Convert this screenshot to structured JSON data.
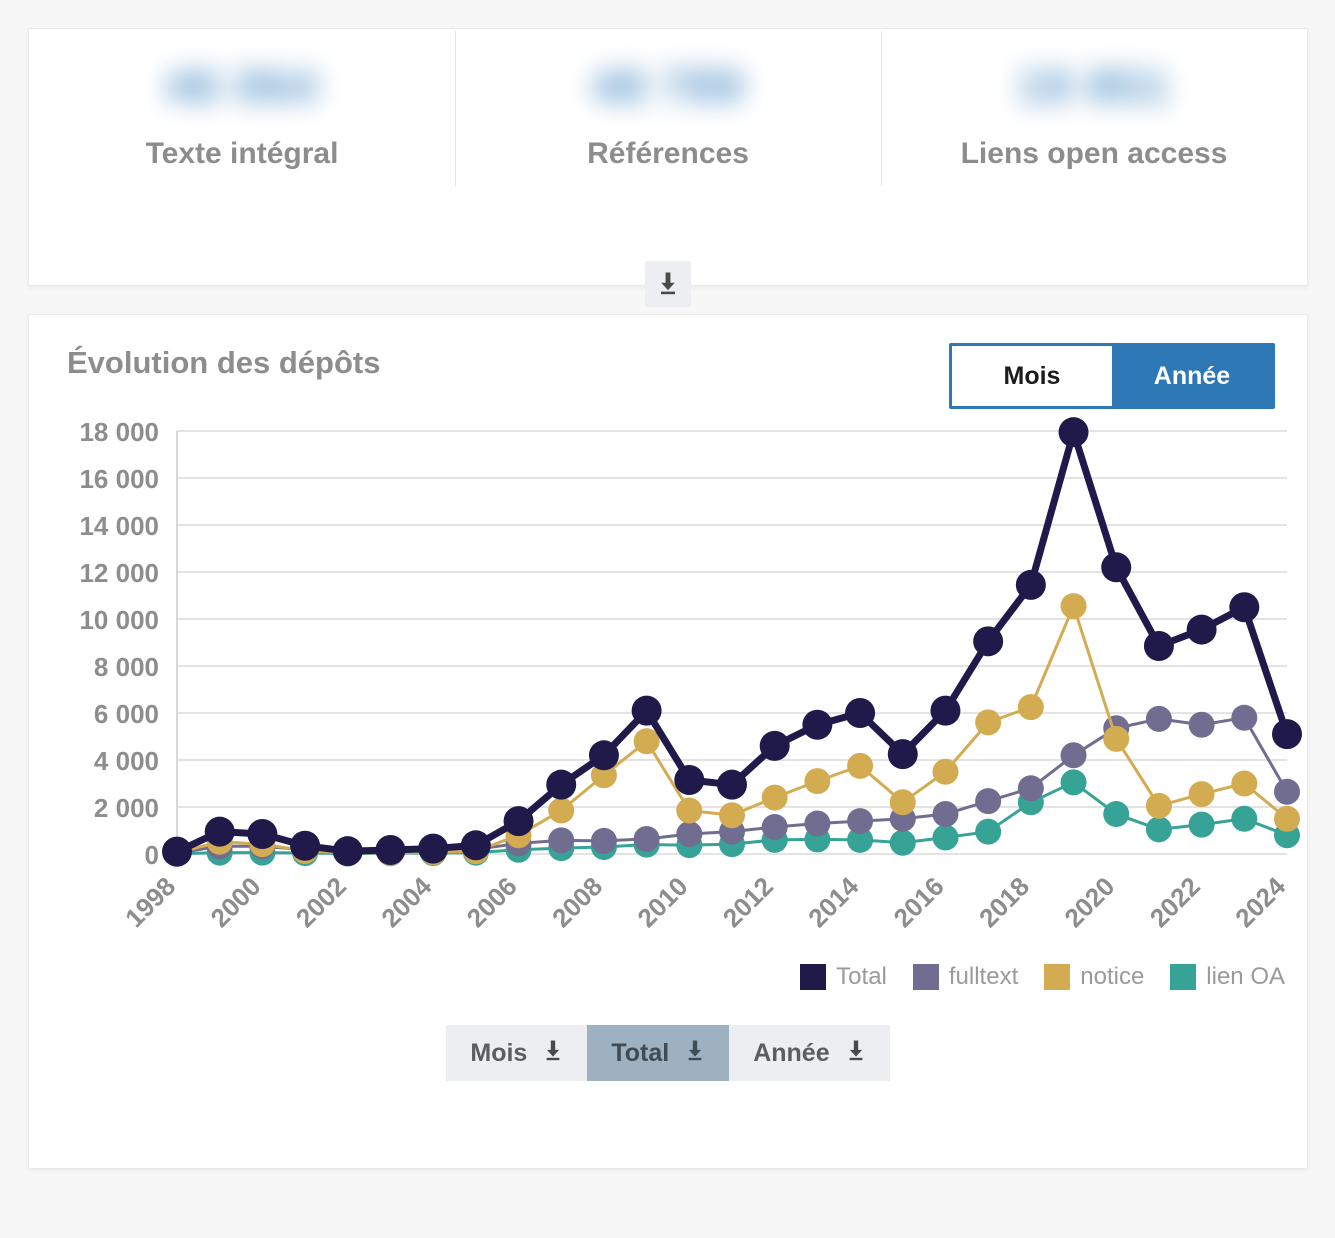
{
  "stats": {
    "items": [
      {
        "value": "46 064",
        "label": "Texte intégral",
        "redacted": true
      },
      {
        "value": "48 789",
        "label": "Références",
        "redacted": true
      },
      {
        "value": "19 851",
        "label": "Liens open access",
        "redacted": true
      }
    ],
    "download_icon": "download-icon"
  },
  "chart_panel": {
    "title": "Évolution des dépôts",
    "granularity": {
      "options": [
        "Mois",
        "Année"
      ],
      "selected": "Année"
    },
    "exports": [
      {
        "label": "Mois",
        "icon": "download-icon",
        "highlighted": false
      },
      {
        "label": "Total",
        "icon": "download-icon",
        "highlighted": true
      },
      {
        "label": "Année",
        "icon": "download-icon",
        "highlighted": false
      }
    ]
  },
  "colors": {
    "accent_blue": "#2e79b5",
    "total": "#1f1a4a",
    "fulltext": "#706d90",
    "notice": "#d3ac52",
    "lien_oa": "#37a396",
    "grid": "#e3e3e3",
    "axis_text": "#8d8d8d",
    "page_bg": "#f7f7f7",
    "card_bg": "#ffffff",
    "export_bg": "#eceef1",
    "export_highlight": "#9db1c1"
  },
  "chart_data": {
    "type": "line",
    "title": "Évolution des dépôts",
    "xlabel": "",
    "ylabel": "",
    "grid": true,
    "legend_position": "bottom-right",
    "ylim": [
      0,
      18000
    ],
    "yticks": [
      0,
      2000,
      4000,
      6000,
      8000,
      10000,
      12000,
      14000,
      16000,
      18000
    ],
    "ytick_labels": [
      "0",
      "2 000",
      "4 000",
      "6 000",
      "8 000",
      "10 000",
      "12 000",
      "14 000",
      "16 000",
      "18 000"
    ],
    "x": [
      1998,
      1999,
      2000,
      2001,
      2002,
      2003,
      2004,
      2005,
      2006,
      2007,
      2008,
      2009,
      2010,
      2011,
      2012,
      2013,
      2014,
      2015,
      2016,
      2017,
      2018,
      2019,
      2020,
      2021,
      2022,
      2023,
      2024
    ],
    "xtick_labels": [
      "1998",
      "2000",
      "2002",
      "2004",
      "2006",
      "2008",
      "2010",
      "2012",
      "2014",
      "2016",
      "2018",
      "2020",
      "2022",
      "2024"
    ],
    "series": [
      {
        "name": "Total",
        "color": "#1f1a4a",
        "values": [
          100,
          950,
          850,
          350,
          120,
          170,
          230,
          370,
          1400,
          2950,
          4200,
          6100,
          3150,
          2950,
          4600,
          5500,
          6000,
          4250,
          6100,
          9050,
          11450,
          17950,
          12200,
          8850,
          9550,
          10500,
          5100
        ]
      },
      {
        "name": "fulltext",
        "color": "#706d90",
        "values": [
          40,
          330,
          330,
          180,
          70,
          100,
          130,
          200,
          450,
          580,
          560,
          640,
          850,
          950,
          1150,
          1300,
          1400,
          1500,
          1700,
          2250,
          2800,
          4200,
          5350,
          5750,
          5500,
          5800,
          2650
        ]
      },
      {
        "name": "notice",
        "color": "#d3ac52",
        "values": [
          50,
          520,
          420,
          130,
          40,
          50,
          70,
          120,
          800,
          1850,
          3350,
          4800,
          1850,
          1650,
          2400,
          3100,
          3750,
          2200,
          3500,
          5600,
          6250,
          10550,
          4900,
          2050,
          2550,
          3000,
          1500
        ]
      },
      {
        "name": "lien OA",
        "color": "#37a396",
        "values": [
          10,
          60,
          60,
          40,
          20,
          30,
          40,
          60,
          180,
          250,
          300,
          400,
          380,
          420,
          600,
          620,
          600,
          480,
          700,
          950,
          2200,
          3050,
          1700,
          1050,
          1250,
          1500,
          800
        ]
      }
    ]
  }
}
